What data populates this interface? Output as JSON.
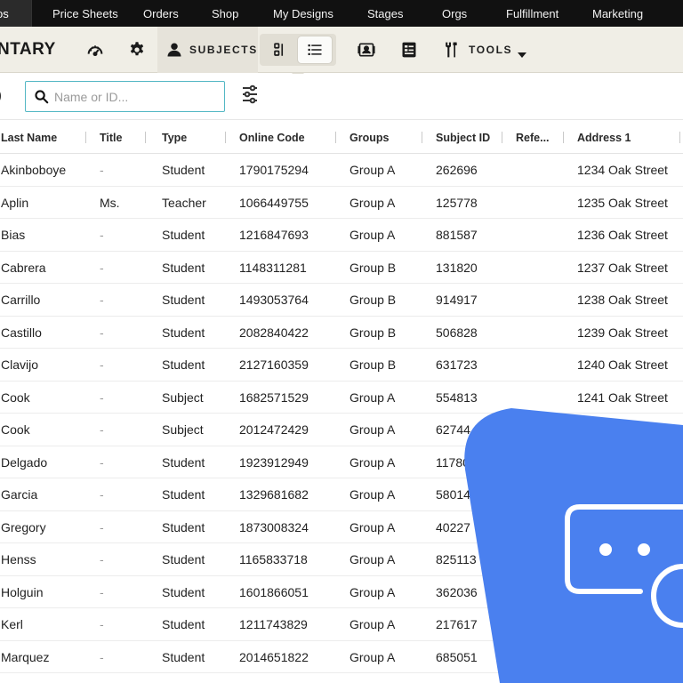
{
  "nav": {
    "first_label": "os",
    "items": [
      "Price Sheets",
      "Orders",
      "Shop",
      "My Designs",
      "Stages",
      "Orgs",
      "Fulfillment",
      "Marketing"
    ]
  },
  "toolbar": {
    "brand": "NTARY",
    "subjects_label": "SUBJECTS",
    "tools_label": "TOOLS",
    "icons": [
      "dashboard-icon",
      "gear-icon",
      "user-icon",
      "card-view-icon",
      "list-view-icon",
      "photo-card-icon",
      "id-card-icon",
      "wrench-screwdriver-icon",
      "caret-down-icon"
    ]
  },
  "filter": {
    "paren_text": ")",
    "search_placeholder": "Name or ID...",
    "search_value": ""
  },
  "table": {
    "columns": [
      "Last Name",
      "Title",
      "Type",
      "Online Code",
      "Groups",
      "Subject ID",
      "Refe...",
      "Address 1"
    ],
    "rows": [
      {
        "last": "Akinboboye",
        "title": "-",
        "type": "Student",
        "code": "1790175294",
        "group": "Group A",
        "sid": "262696",
        "ref": "",
        "addr": "1234 Oak Street"
      },
      {
        "last": "Aplin",
        "title": "Ms.",
        "type": "Teacher",
        "code": "1066449755",
        "group": "Group A",
        "sid": "125778",
        "ref": "",
        "addr": "1235 Oak Street"
      },
      {
        "last": "Bias",
        "title": "-",
        "type": "Student",
        "code": "1216847693",
        "group": "Group A",
        "sid": "881587",
        "ref": "",
        "addr": "1236 Oak Street"
      },
      {
        "last": "Cabrera",
        "title": "-",
        "type": "Student",
        "code": "1148311281",
        "group": "Group B",
        "sid": "131820",
        "ref": "",
        "addr": "1237 Oak Street"
      },
      {
        "last": "Carrillo",
        "title": "-",
        "type": "Student",
        "code": "1493053764",
        "group": "Group B",
        "sid": "914917",
        "ref": "",
        "addr": "1238 Oak Street"
      },
      {
        "last": "Castillo",
        "title": "-",
        "type": "Student",
        "code": "2082840422",
        "group": "Group B",
        "sid": "506828",
        "ref": "",
        "addr": "1239 Oak Street"
      },
      {
        "last": "Clavijo",
        "title": "-",
        "type": "Student",
        "code": "2127160359",
        "group": "Group B",
        "sid": "631723",
        "ref": "",
        "addr": "1240 Oak Street"
      },
      {
        "last": "Cook",
        "title": "-",
        "type": "Subject",
        "code": "1682571529",
        "group": "Group A",
        "sid": "554813",
        "ref": "",
        "addr": "1241 Oak Street"
      },
      {
        "last": "Cook",
        "title": "-",
        "type": "Subject",
        "code": "2012472429",
        "group": "Group A",
        "sid": "62744",
        "ref": "",
        "addr": ""
      },
      {
        "last": "Delgado",
        "title": "-",
        "type": "Student",
        "code": "1923912949",
        "group": "Group A",
        "sid": "11780",
        "ref": "",
        "addr": ""
      },
      {
        "last": "Garcia",
        "title": "-",
        "type": "Student",
        "code": "1329681682",
        "group": "Group A",
        "sid": "58014",
        "ref": "",
        "addr": ""
      },
      {
        "last": "Gregory",
        "title": "-",
        "type": "Student",
        "code": "1873008324",
        "group": "Group A",
        "sid": "40227",
        "ref": "",
        "addr": ""
      },
      {
        "last": "Henss",
        "title": "-",
        "type": "Student",
        "code": "1165833718",
        "group": "Group A",
        "sid": "825113",
        "ref": "",
        "addr": ""
      },
      {
        "last": "Holguin",
        "title": "-",
        "type": "Student",
        "code": "1601866051",
        "group": "Group A",
        "sid": "362036",
        "ref": "",
        "addr": ""
      },
      {
        "last": "Kerl",
        "title": "-",
        "type": "Student",
        "code": "1211743829",
        "group": "Group A",
        "sid": "217617",
        "ref": "",
        "addr": ""
      },
      {
        "last": "Marquez",
        "title": "-",
        "type": "Student",
        "code": "2014651822",
        "group": "Group A",
        "sid": "685051",
        "ref": "",
        "addr": ""
      }
    ]
  },
  "overlay": {
    "shape_color": "#4a80ef",
    "icon": "chat-bubble-icon"
  },
  "colors": {
    "accent": "#53b7c4",
    "nav_bg": "#111111",
    "toolbar_bg": "#f0eee6"
  }
}
